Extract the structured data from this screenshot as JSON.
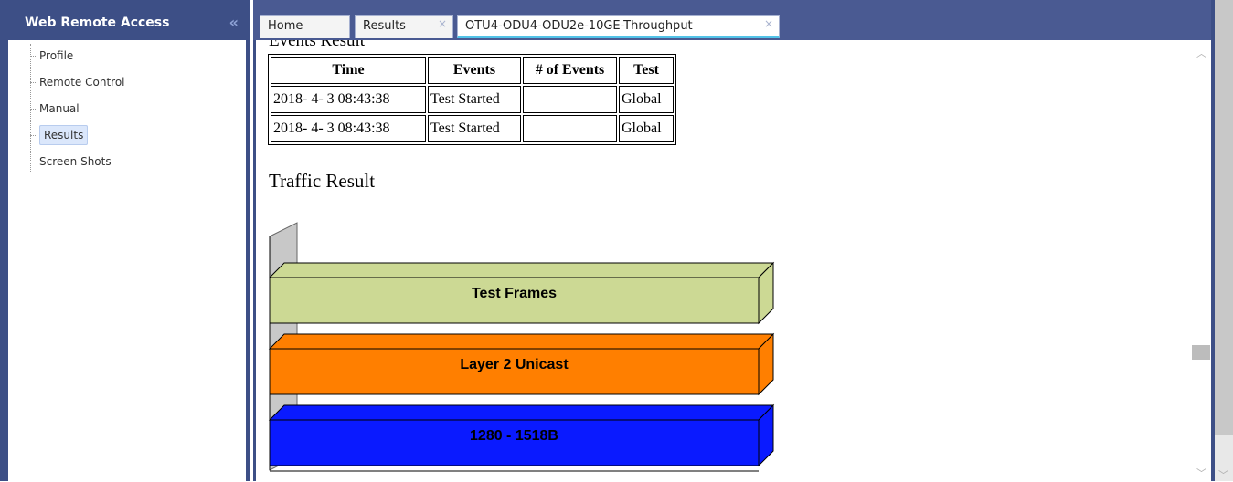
{
  "sidebar": {
    "title": "Web Remote Access",
    "collapse_glyph": "«",
    "items": [
      {
        "label": "Profile"
      },
      {
        "label": "Remote Control"
      },
      {
        "label": "Manual"
      },
      {
        "label": "Results",
        "selected": true
      },
      {
        "label": "Screen Shots"
      }
    ]
  },
  "tabs": [
    {
      "label": "Home",
      "closable": false,
      "active": false
    },
    {
      "label": "Results",
      "closable": true,
      "active": false
    },
    {
      "label": "OTU4-ODU4-ODU2e-10GE-Throughput",
      "closable": true,
      "active": true
    }
  ],
  "close_glyph": "×",
  "events": {
    "title": "Events Result",
    "headers": [
      "Time",
      "Events",
      "# of Events",
      "Test"
    ],
    "rows": [
      [
        "2018- 4- 3 08:43:38",
        "Test Started",
        "",
        "Global"
      ],
      [
        "2018- 4- 3 08:43:38",
        "Test Started",
        "",
        "Global"
      ]
    ]
  },
  "traffic": {
    "title": "Traffic Result"
  },
  "chart_data": {
    "type": "bar",
    "orientation": "horizontal",
    "categories": [
      "Test Frames",
      "Layer 2 Unicast",
      "1280 - 1518B"
    ],
    "values": [
      100,
      100,
      100
    ],
    "unit": "%",
    "xlim": [
      0,
      100
    ],
    "ticks": [
      "0%",
      "50%",
      "100%"
    ],
    "colors": [
      "#ccd994",
      "#ff7f00",
      "#0a1aff"
    ],
    "grid": false,
    "legend": "none"
  },
  "colors": {
    "header_bg": "#3d4f86",
    "active_tab_underline": "#52c3e8"
  }
}
